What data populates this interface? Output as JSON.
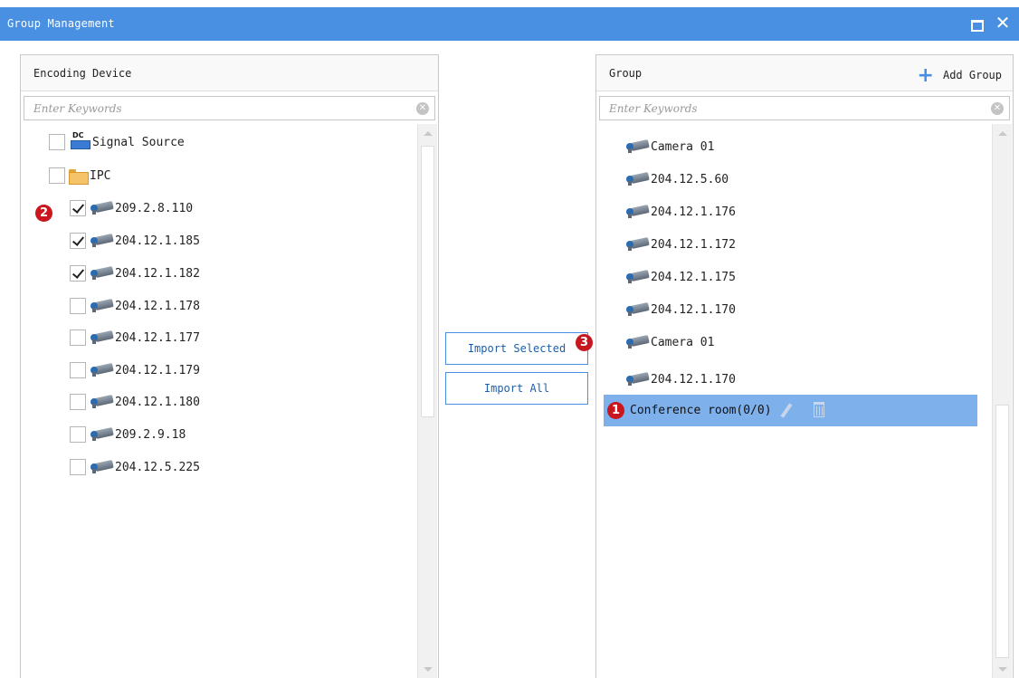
{
  "window": {
    "title": "Group Management",
    "accent_color": "#4a90e2",
    "maximize_icon": "maximize-icon",
    "close_glyph": "✕"
  },
  "left_panel": {
    "title": "Encoding Device",
    "search_placeholder": "Enter Keywords",
    "items": [
      {
        "label": "Signal Source",
        "icon": "signal-source-icon",
        "checked": false
      },
      {
        "label": "IPC",
        "icon": "folder-icon",
        "checked": false,
        "expanded": true
      },
      {
        "label": "209.2.8.110",
        "icon": "camera-icon",
        "checked": true
      },
      {
        "label": "204.12.1.185",
        "icon": "camera-icon",
        "checked": true
      },
      {
        "label": "204.12.1.182",
        "icon": "camera-icon",
        "checked": true
      },
      {
        "label": "204.12.1.178",
        "icon": "camera-icon",
        "checked": false
      },
      {
        "label": "204.12.1.177",
        "icon": "camera-icon",
        "checked": false
      },
      {
        "label": "204.12.1.179",
        "icon": "camera-icon",
        "checked": false
      },
      {
        "label": "204.12.1.180",
        "icon": "camera-icon",
        "checked": false
      },
      {
        "label": "209.2.9.18",
        "icon": "camera-icon",
        "checked": false
      },
      {
        "label": "204.12.5.225",
        "icon": "camera-icon",
        "checked": false
      }
    ]
  },
  "center": {
    "import_selected": "Import Selected",
    "import_all": "Import All"
  },
  "right_panel": {
    "title": "Group",
    "add_group": "Add Group",
    "search_placeholder": "Enter Keywords",
    "items": [
      {
        "label": "Camera 01",
        "icon": "camera-icon"
      },
      {
        "label": "204.12.5.60",
        "icon": "camera-icon"
      },
      {
        "label": "204.12.1.176",
        "icon": "camera-icon"
      },
      {
        "label": "204.12.1.172",
        "icon": "camera-icon"
      },
      {
        "label": "204.12.1.175",
        "icon": "camera-icon"
      },
      {
        "label": "204.12.1.170",
        "icon": "camera-icon"
      },
      {
        "label": "Camera 01",
        "icon": "camera-icon"
      },
      {
        "label": "204.12.1.170",
        "icon": "camera-icon"
      }
    ],
    "selected_group": "Conference room(0/0)",
    "selected_color": "#7eb0ec"
  },
  "badges": {
    "one": "1",
    "two": "2",
    "three": "3",
    "color": "#c8171e"
  }
}
